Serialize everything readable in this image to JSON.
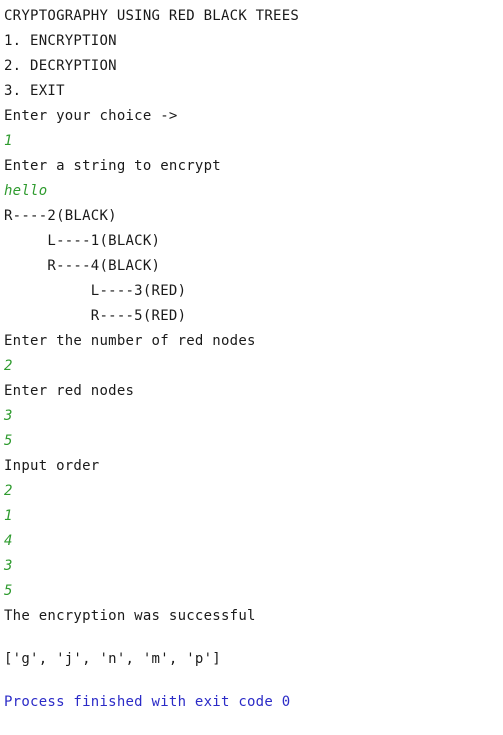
{
  "console": {
    "name": "python-run-console",
    "background_color": "#ffffff",
    "output_color": "#1a1a1a",
    "input_color": "#2f9b2f",
    "system_color": "#2b2bc7",
    "lines": [
      {
        "text": "CRYPTOGRAPHY USING RED BLACK TREES",
        "kind": "out"
      },
      {
        "text": "1. ENCRYPTION",
        "kind": "out"
      },
      {
        "text": "2. DECRYPTION",
        "kind": "out"
      },
      {
        "text": "3. EXIT",
        "kind": "out"
      },
      {
        "text": "Enter your choice ->",
        "kind": "out"
      },
      {
        "text": "1",
        "kind": "in"
      },
      {
        "text": "Enter a string to encrypt",
        "kind": "out"
      },
      {
        "text": "hello",
        "kind": "in"
      },
      {
        "text": "R----2(BLACK)",
        "kind": "out"
      },
      {
        "text": "     L----1(BLACK)",
        "kind": "out"
      },
      {
        "text": "     R----4(BLACK)",
        "kind": "out"
      },
      {
        "text": "          L----3(RED)",
        "kind": "out"
      },
      {
        "text": "          R----5(RED)",
        "kind": "out"
      },
      {
        "text": "Enter the number of red nodes",
        "kind": "out"
      },
      {
        "text": "2",
        "kind": "in"
      },
      {
        "text": "Enter red nodes",
        "kind": "out"
      },
      {
        "text": "3",
        "kind": "in"
      },
      {
        "text": "5",
        "kind": "in"
      },
      {
        "text": "Input order",
        "kind": "out"
      },
      {
        "text": "2",
        "kind": "in"
      },
      {
        "text": "1",
        "kind": "in"
      },
      {
        "text": "4",
        "kind": "in"
      },
      {
        "text": "3",
        "kind": "in"
      },
      {
        "text": "5",
        "kind": "in"
      },
      {
        "text": "The encryption was successful",
        "kind": "out"
      },
      {
        "text": "",
        "kind": "blank"
      },
      {
        "text": "['g', 'j', 'n', 'm', 'p']",
        "kind": "out"
      },
      {
        "text": "",
        "kind": "blank"
      },
      {
        "text": "Process finished with exit code 0",
        "kind": "sys"
      }
    ]
  },
  "program": {
    "title": "CRYPTOGRAPHY USING RED BLACK TREES",
    "menu_options": [
      "1. ENCRYPTION",
      "2. DECRYPTION",
      "3. EXIT"
    ],
    "prompt_choice": "Enter your choice ->",
    "chosen_option": "1",
    "prompt_string": "Enter a string to encrypt",
    "input_string": "hello",
    "tree": [
      {
        "direction": "R",
        "key": "2",
        "color": "BLACK",
        "depth": 0
      },
      {
        "direction": "L",
        "key": "1",
        "color": "BLACK",
        "depth": 1
      },
      {
        "direction": "R",
        "key": "4",
        "color": "BLACK",
        "depth": 1
      },
      {
        "direction": "L",
        "key": "3",
        "color": "RED",
        "depth": 2
      },
      {
        "direction": "R",
        "key": "5",
        "color": "RED",
        "depth": 2
      }
    ],
    "prompt_red_count": "Enter the number of red nodes",
    "red_count": "2",
    "prompt_red_nodes": "Enter red nodes",
    "red_nodes": [
      "3",
      "5"
    ],
    "prompt_input_order": "Input order",
    "input_order": [
      "2",
      "1",
      "4",
      "3",
      "5"
    ],
    "result_message": "The encryption was successful",
    "cipher_list": "['g', 'j', 'n', 'm', 'p']",
    "exit_message": "Process finished with exit code 0"
  }
}
